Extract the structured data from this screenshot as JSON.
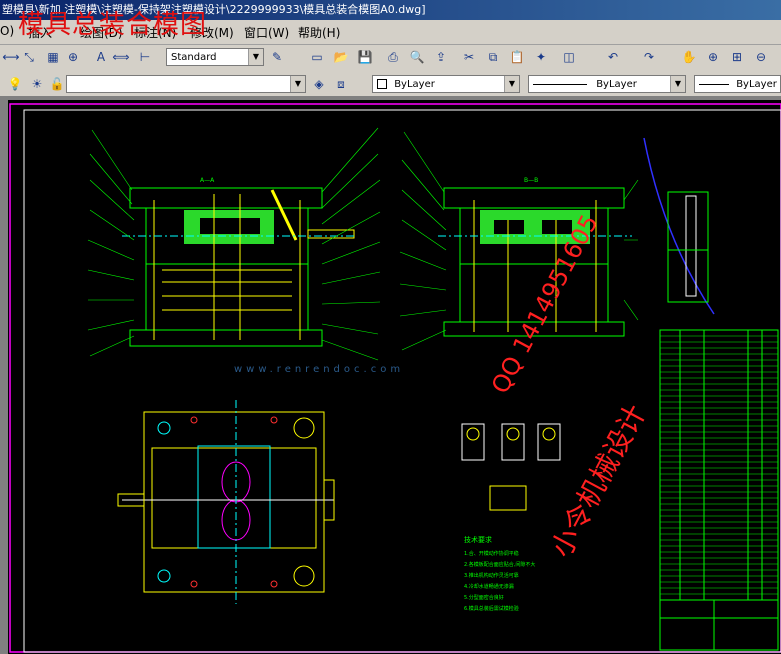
{
  "window": {
    "title": "塑模具\\新加 注塑模\\注塑模-保持架注塑模设计\\2229999933\\模具总装合模图A0.dwg]",
    "overlay_title": "模具总装合模图"
  },
  "menu": {
    "items": [
      "O)",
      "插入",
      "绘图(D)",
      "标注(N)",
      "修改(M)",
      "窗口(W)",
      "帮助(H)"
    ]
  },
  "toolbar": {
    "text_style": "Standard",
    "layer_value": "",
    "color_value": "ByLayer",
    "linetype_value": "ByLayer",
    "lineweight_value": "ByLayer"
  },
  "drawing": {
    "notes_title": "技术要求",
    "notes_lines": [
      "1.合、开模动作协调平稳",
      "2.各模板配合面应贴合,间隙不大",
      "3.推出机构动作灵活可靠",
      "4.冷却水道畅通无渗漏",
      "5.分型面密合良好",
      "6.模具总装后需试模检验"
    ],
    "overlay_qq": "QQ 1414951605",
    "overlay_brand": "小令机械设计",
    "watermark_site": "www.renrendoc.com"
  },
  "colors": {
    "canvas_bg": "#000000",
    "frame": "#ff00ff",
    "geometry": "#00ff00",
    "accent": "#ffff00",
    "cyan": "#00ffff",
    "red": "#ff2020"
  }
}
